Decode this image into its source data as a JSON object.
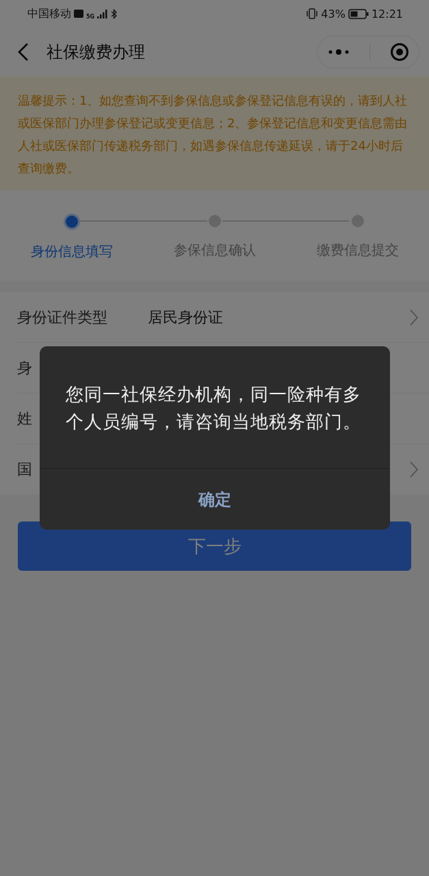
{
  "status_bar": {
    "carrier": "中国移动",
    "network": "5G",
    "battery": "43%",
    "time": "12:21"
  },
  "nav": {
    "title": "社保缴费办理"
  },
  "notice": {
    "text": "温馨提示：1、如您查询不到参保信息或参保登记信息有误的，请到人社或医保部门办理参保登记或变更信息；2、参保登记信息和变更信息需由人社或医保部门传递税务部门，如遇参保信息传递延误，请于24小时后查询缴费。"
  },
  "steps": [
    {
      "label": "身份信息填写",
      "selected": true
    },
    {
      "label": "参保信息确认",
      "selected": false
    },
    {
      "label": "缴费信息提交",
      "selected": false
    }
  ],
  "form_rows": [
    {
      "label": "身份证件类型",
      "value": "居民身份证",
      "chevron": true
    },
    {
      "label": "身",
      "chevron": false
    },
    {
      "label": "姓",
      "chevron": false
    },
    {
      "label": "国",
      "chevron": true
    }
  ],
  "next_button": "下一步",
  "dialog": {
    "message": "您同一社保经办机构，同一险种有多个人员编号，请咨询当地税务部门。",
    "confirm": "确定"
  }
}
